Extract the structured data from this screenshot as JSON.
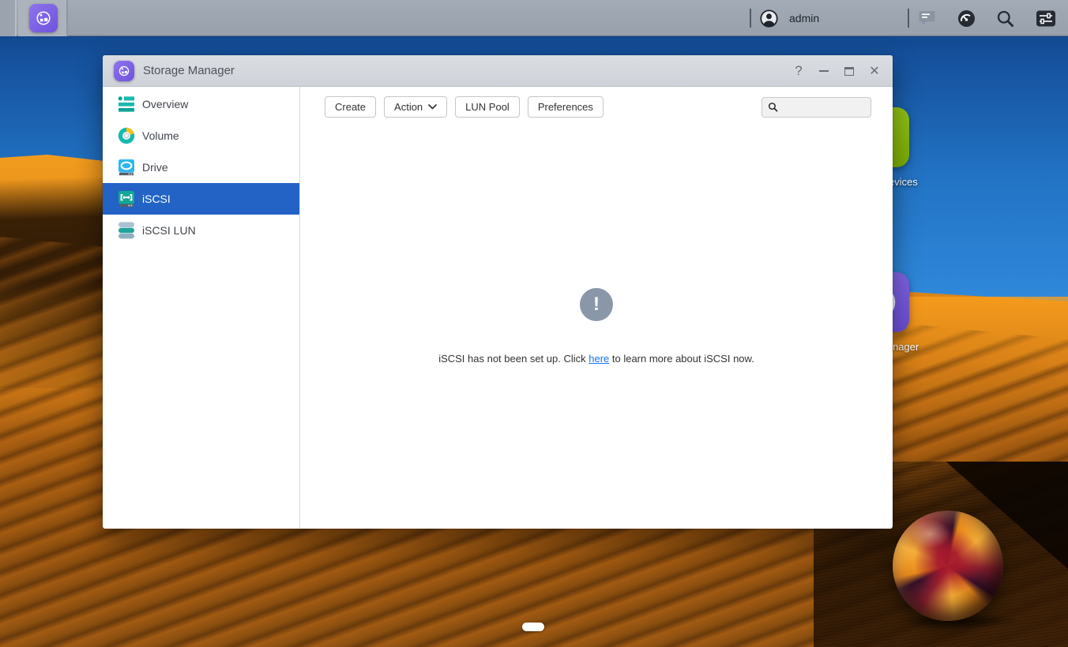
{
  "taskbar": {
    "user_name": "admin",
    "icons": [
      "app-launcher",
      "user-avatar",
      "notifications",
      "system-monitor",
      "search",
      "task-switcher"
    ]
  },
  "window": {
    "title": "Storage Manager",
    "controls": {
      "help": "?",
      "close": "✕"
    },
    "sidebar": {
      "selected": "iSCSI",
      "items": [
        {
          "label": "Overview"
        },
        {
          "label": "Volume"
        },
        {
          "label": "Drive"
        },
        {
          "label": "iSCSI"
        },
        {
          "label": "iSCSI LUN"
        }
      ]
    },
    "toolbar": {
      "buttons": [
        "Create",
        "Action",
        "LUN Pool",
        "Preferences"
      ],
      "search_placeholder": ""
    },
    "empty_state": {
      "icon_glyph": "!",
      "text_before": "iSCSI has not been set up. Click ",
      "link_text": "here",
      "text_after": " to learn more about iSCSI now."
    }
  },
  "desktop": {
    "shortcuts": [
      {
        "label": "External Devices"
      },
      {
        "label": "Storage Manager"
      }
    ]
  },
  "colors": {
    "selected_row_blue": "#2263c5",
    "link_blue": "#1874e8",
    "brand_purple": "#7e5fe6",
    "empty_icon_gray": "#8a97a8"
  }
}
